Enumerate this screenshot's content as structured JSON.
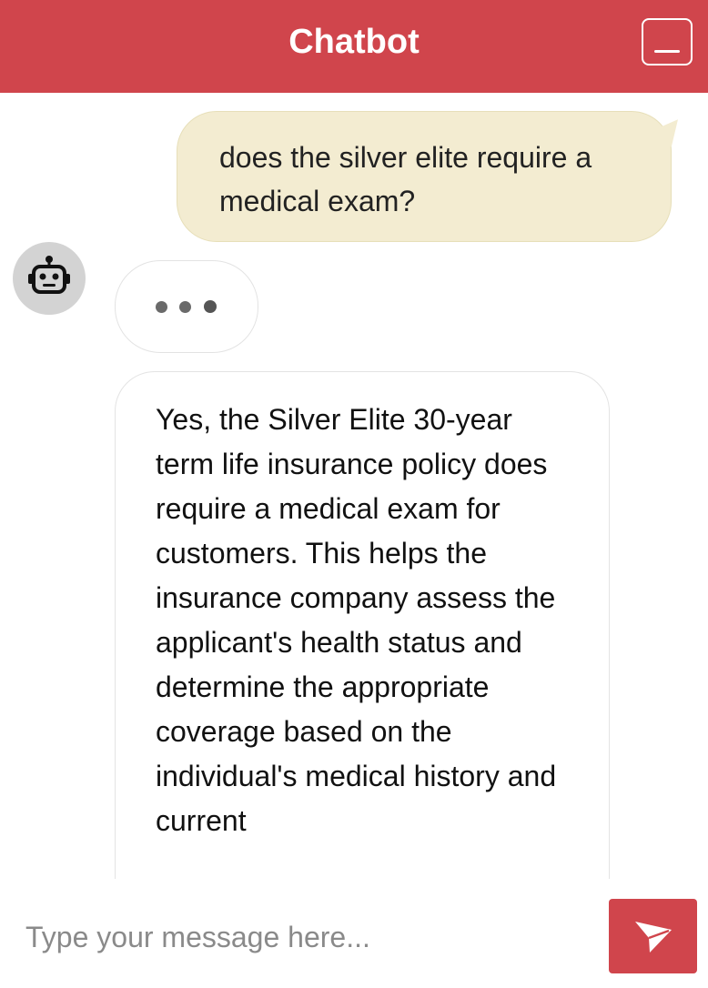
{
  "theme": {
    "accent": "#d0454c",
    "user_bubble_bg": "#f3ecd1"
  },
  "header": {
    "title": "Chatbot",
    "minimize_icon": "minimize-icon"
  },
  "messages": [
    {
      "role": "user",
      "text": "does the silver elite require a medical exam?"
    },
    {
      "role": "bot",
      "typing": true,
      "avatar_icon": "robot-icon"
    },
    {
      "role": "bot",
      "text": "Yes, the Silver Elite 30-year term life insurance policy does require a medical exam for customers. This helps the insurance company assess the applicant's health status and determine the appropriate coverage based on the individual's medical history and current"
    }
  ],
  "composer": {
    "placeholder": "Type your message here...",
    "value": "",
    "send_icon": "send-icon"
  }
}
